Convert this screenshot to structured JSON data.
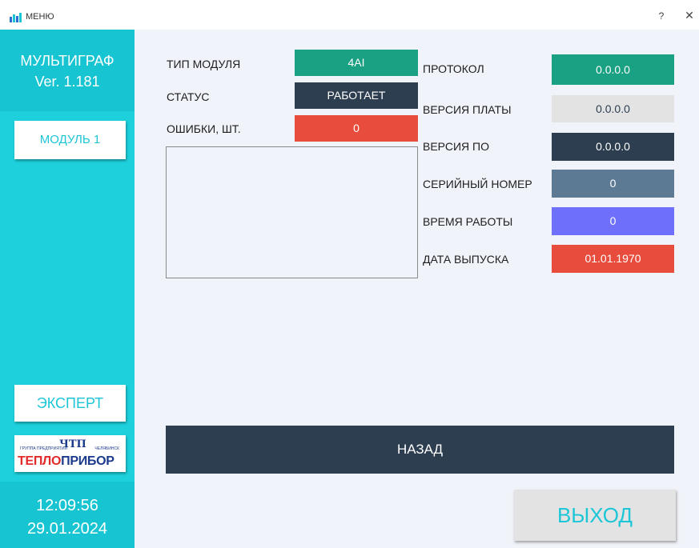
{
  "window": {
    "title": "МЕНЮ",
    "help_label": "?",
    "close_label": "✕"
  },
  "sidebar": {
    "brand_name": "МУЛЬТИГРАФ",
    "version": "Ver. 1.181",
    "module_button": "МОДУЛЬ 1",
    "expert_button": "ЭКСПЕРТ",
    "logo": {
      "small_left": "ГРУППА ПРЕДПРИЯТИЙ",
      "small_right": "ЧЕЛЯБИНСК",
      "abbr": "ЧТП",
      "word_red": "ТЕПЛО",
      "word_blue": "ПРИБОР"
    },
    "time": "12:09:56",
    "date": "29.01.2024"
  },
  "module_info": {
    "type_label": "ТИП МОДУЛЯ",
    "type_value": "4AI",
    "status_label": "СТАТУС",
    "status_value": "РАБОТАЕТ",
    "errors_label": "ОШИБКИ, ШТ.",
    "errors_value": "0",
    "log_text": ""
  },
  "details": {
    "protocol_label": "ПРОТОКОЛ",
    "protocol_value": "0.0.0.0",
    "board_label": "ВЕРСИЯ ПЛАТЫ",
    "board_value": "0.0.0.0",
    "software_label": "ВЕРСИЯ ПО",
    "software_value": "0.0.0.0",
    "serial_label": "СЕРИЙНЫЙ НОМЕР",
    "serial_value": "0",
    "uptime_label": "ВРЕМЯ РАБОТЫ",
    "uptime_value": "0",
    "release_label": "ДАТА ВЫПУСКА",
    "release_value": "01.01.1970"
  },
  "buttons": {
    "back": "НАЗАД",
    "exit": "ВЫХОД"
  },
  "colors": {
    "sidebar": "#1dd0dc",
    "sidebar_dark": "#16c4d2",
    "green": "#1aa082",
    "navy": "#2d3e50",
    "red": "#e74c3c",
    "light_gray": "#e3e3e3",
    "slate": "#5d7a94",
    "violet": "#6e6ffb",
    "background": "#f0f3f9"
  },
  "icons": {
    "app_icon": "bar-chart-icon"
  }
}
